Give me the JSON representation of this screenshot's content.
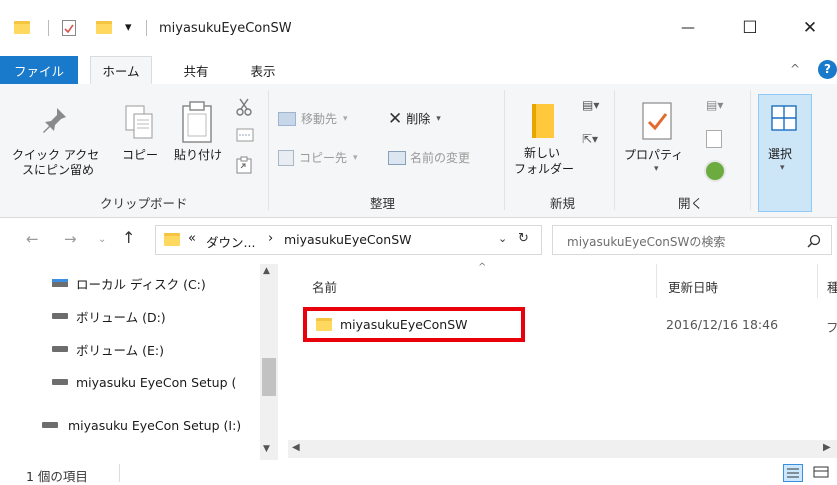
{
  "window": {
    "title": "miyasukuEyeConSW",
    "minimize_glyph": "—",
    "maximize_glyph": "☐",
    "close_glyph": "✕",
    "qa_dropdown_glyph": "▾"
  },
  "ribbon_tabs": {
    "file": "ファイル",
    "home": "ホーム",
    "share": "共有",
    "view": "表示"
  },
  "ribbon": {
    "clipboard": {
      "pin_label_1": "クイック アクセ",
      "pin_label_2": "スにピン留め",
      "copy_label": "コピー",
      "paste_label": "貼り付け",
      "group_label": "クリップボード"
    },
    "organize": {
      "move_to": "移動先",
      "delete": "削除",
      "copy_to": "コピー先",
      "rename": "名前の変更",
      "group_label": "整理"
    },
    "new": {
      "new_folder_1": "新しい",
      "new_folder_2": "フォルダー",
      "group_label": "新規"
    },
    "open": {
      "properties": "プロパティ",
      "group_label": "開く"
    },
    "select": {
      "select_label": "選択"
    }
  },
  "address": {
    "prefix": "«",
    "crumb_parent": "ダウン...",
    "separator": "›",
    "crumb_current": "miyasukuEyeConSW",
    "search_placeholder": "miyasukuEyeConSWの検索"
  },
  "nav_pane": {
    "items": [
      {
        "label": "ローカル ディスク (C:)"
      },
      {
        "label": "ボリューム (D:)"
      },
      {
        "label": "ボリューム (E:)"
      },
      {
        "label": "miyasuku EyeCon Setup ("
      },
      {
        "label": "miyasuku EyeCon Setup (I:)"
      }
    ]
  },
  "file_list": {
    "headers": {
      "name": "名前",
      "date": "更新日時",
      "type": "種"
    },
    "rows": [
      {
        "name": "miyasukuEyeConSW",
        "date": "2016/12/16 18:46",
        "type": "フ"
      }
    ],
    "highlight_color": "#e8000b"
  },
  "status_bar": {
    "count": "1 個の項目"
  }
}
